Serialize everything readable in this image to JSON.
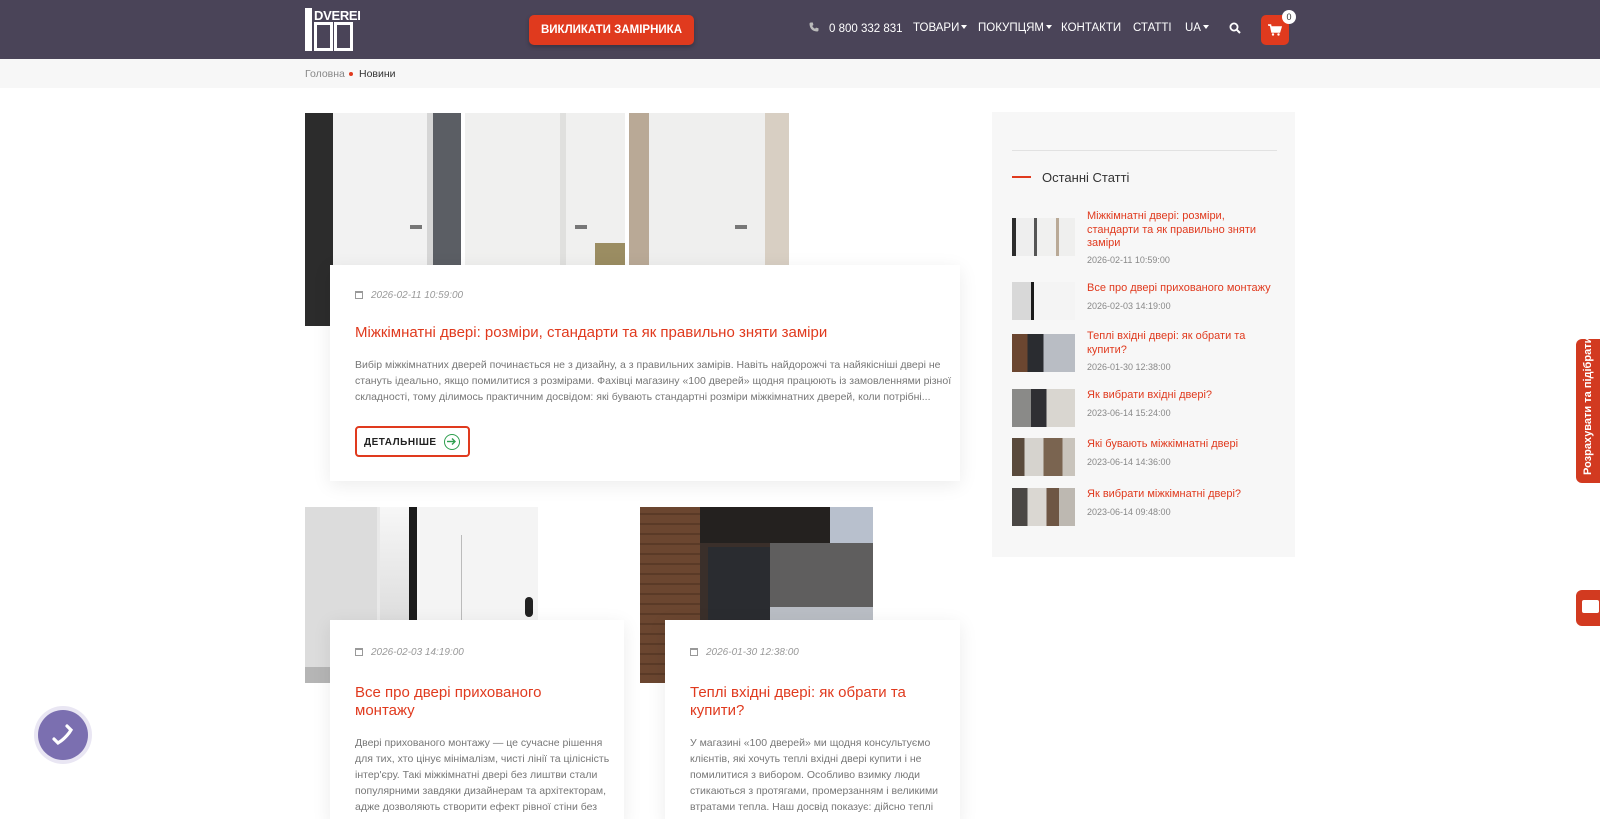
{
  "header": {
    "logo_text": "DVEREI",
    "cta_label": "ВИКЛИКАТИ ЗАМІРНИКА",
    "phone": "0 800 332 831",
    "nav": [
      "ТОВАРИ",
      "ПОКУПЦЯМ",
      "КОНТАКТИ",
      "СТАТТІ",
      "UA"
    ],
    "cart_count": "0",
    "colors": {
      "bar": "#4a4458",
      "accent": "#e03a1e"
    }
  },
  "breadcrumb": {
    "home": "Головна",
    "current": "Новини"
  },
  "featured": {
    "date": "2026-02-11 10:59:00",
    "title": "Міжкімнатні двері: розміри, стандарти та як правильно зняти заміри",
    "excerpt_lines": [
      "Вибір міжкімнатних дверей починається не з дизайну, а з правильних замірів. Навіть найдорожчі та найякісніші двері не",
      "стануть ідеально, якщо помилитися з розмірами. Фахівці магазину «100 дверей» щодня працюють із замовленнями різної",
      "складності, тому ділимось практичним досвідом: які бувають стандартні розміри міжкімнатних дверей, коли потрібні..."
    ],
    "more_label": "ДЕТАЛЬНІШЕ"
  },
  "cards": [
    {
      "date": "2026-02-03 14:19:00",
      "title_lines": [
        "Все про двері прихованого",
        "монтажу"
      ],
      "excerpt_lines": [
        "Двері прихованого монтажу — це сучасне рішення",
        "для тих, хто цінує мінімалізм, чисті лінії та цілісність",
        "інтер'єру. Такі міжкімнатні двері без лиштви стали",
        "популярними завдяки дизайнерам та архітекторам,",
        "адже дозволяють створити ефект рівної стіни без"
      ]
    },
    {
      "date": "2026-01-30 12:38:00",
      "title_lines": [
        "Теплі вхідні двері: як обрати та",
        "купити?"
      ],
      "excerpt_lines": [
        "У магазині «100 дверей» ми щодня консультуємо",
        "клієнтів, які хочуть теплі вхідні двері купити і не",
        "помилитися з вибором. Особливо взимку люди",
        "стикаються з протягами, промерзанням і великими",
        "втратами тепла. Наш досвід показує: дійсно теплі"
      ]
    }
  ],
  "sidebar": {
    "title": "Останні Статті",
    "items": [
      {
        "title_lines": [
          "Міжкімнатні двері: розміри,",
          "стандарти та як правильно зняти",
          "заміри"
        ],
        "date": "2026-02-11 10:59:00"
      },
      {
        "title_lines": [
          "Все про двері прихованого монтажу"
        ],
        "date": "2026-02-03 14:19:00"
      },
      {
        "title_lines": [
          "Теплі вхідні двері: як обрати та",
          "купити?"
        ],
        "date": "2026-01-30 12:38:00"
      },
      {
        "title_lines": [
          "Як вибрати вхідні двері?"
        ],
        "date": "2023-06-14 15:24:00"
      },
      {
        "title_lines": [
          "Які бувають міжкімнатні двері"
        ],
        "date": "2023-06-14 14:36:00"
      },
      {
        "title_lines": [
          "Як вибрати міжкімнатні двері?"
        ],
        "date": "2023-06-14 09:48:00"
      }
    ]
  },
  "widgets": {
    "side_tab_label": "Розрахувати та підібрати"
  },
  "icons": [
    "phone-icon",
    "search-icon",
    "cart-icon",
    "calendar-icon",
    "arrow-right-icon",
    "chat-icon",
    "call-icon"
  ]
}
